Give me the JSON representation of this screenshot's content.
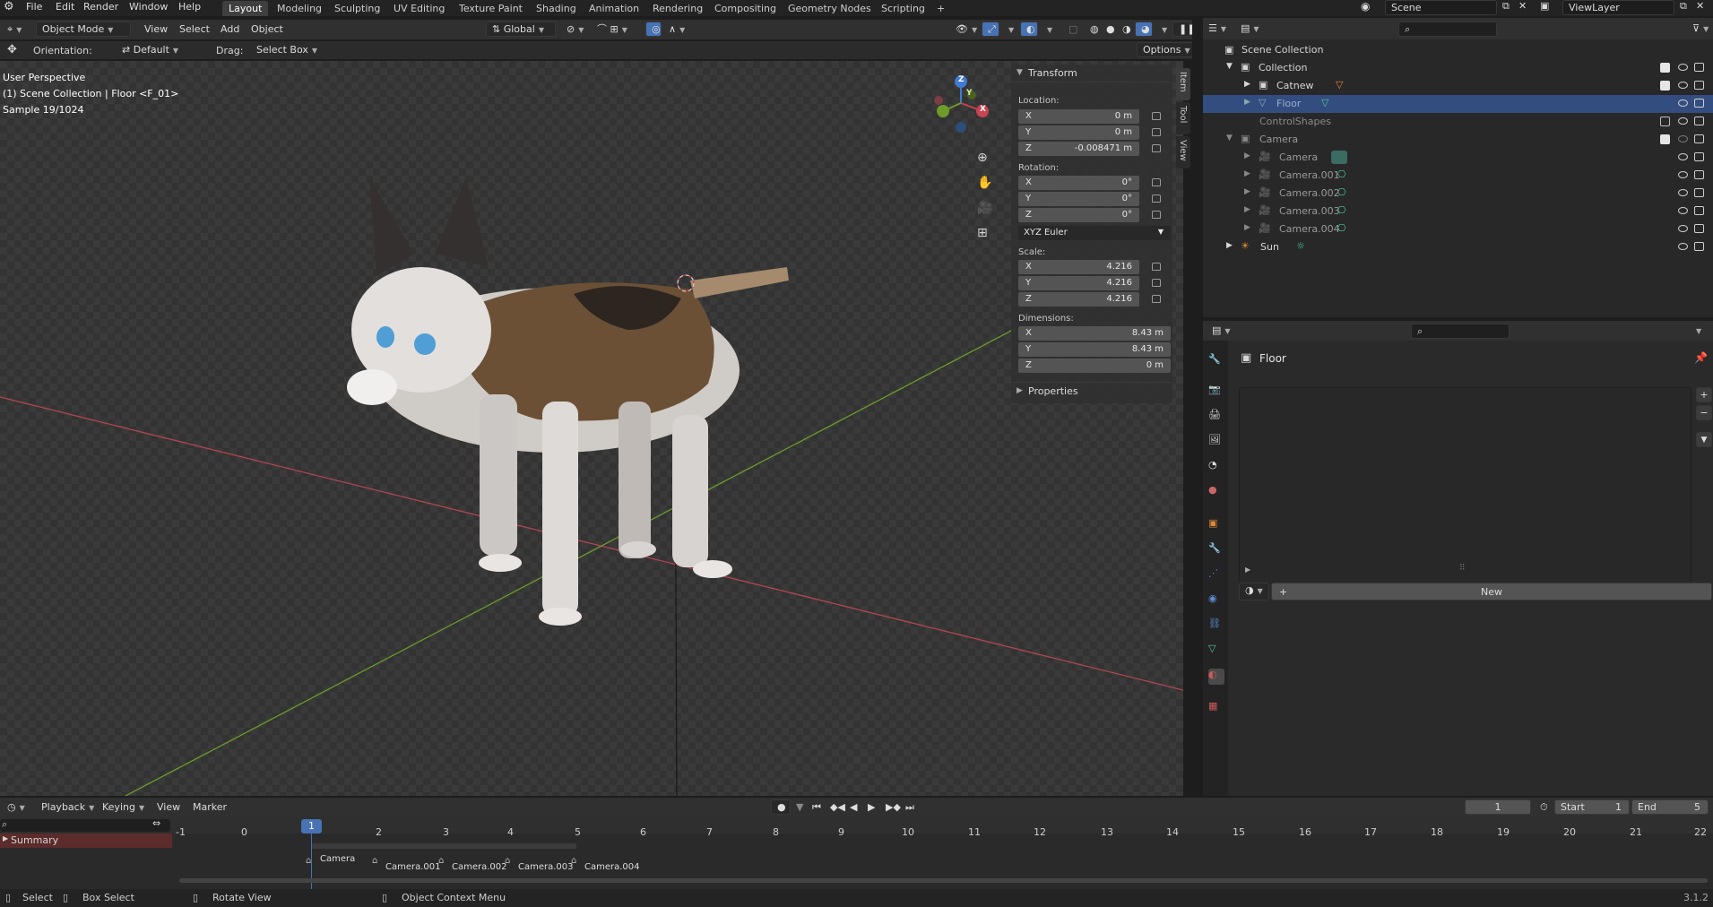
{
  "menu": {
    "items": [
      "File",
      "Edit",
      "Render",
      "Window",
      "Help"
    ]
  },
  "workspaces": [
    "Layout",
    "Modeling",
    "Sculpting",
    "UV Editing",
    "Texture Paint",
    "Shading",
    "Animation",
    "Rendering",
    "Compositing",
    "Geometry Nodes",
    "Scripting",
    "+"
  ],
  "active_workspace": "Layout",
  "scene_name": "Scene",
  "view_layer": "ViewLayer",
  "header": {
    "mode": "Object Mode",
    "view": "View",
    "select": "Select",
    "add": "Add",
    "object": "Object",
    "transform_orientation": "Global"
  },
  "toolsettings": {
    "orientation_label": "Orientation:",
    "orientation_value": "Default",
    "drag_label": "Drag:",
    "drag_value": "Select Box",
    "options": "Options"
  },
  "viewport_info": {
    "line1": "User Perspective",
    "line2": "(1) Scene Collection | Floor <F_01>",
    "line3": "Sample 19/1024"
  },
  "gizmo": {
    "x": "X",
    "y": "Y",
    "z": "Z"
  },
  "npanel": {
    "transform_title": "Transform",
    "location_label": "Location:",
    "location": [
      {
        "axis": "X",
        "value": "0 m"
      },
      {
        "axis": "Y",
        "value": "0 m"
      },
      {
        "axis": "Z",
        "value": "-0.008471 m"
      }
    ],
    "rotation_label": "Rotation:",
    "rotation": [
      {
        "axis": "X",
        "value": "0°"
      },
      {
        "axis": "Y",
        "value": "0°"
      },
      {
        "axis": "Z",
        "value": "0°"
      }
    ],
    "rotation_mode": "XYZ Euler",
    "scale_label": "Scale:",
    "scale": [
      {
        "axis": "X",
        "value": "4.216"
      },
      {
        "axis": "Y",
        "value": "4.216"
      },
      {
        "axis": "Z",
        "value": "4.216"
      }
    ],
    "dimensions_label": "Dimensions:",
    "dimensions": [
      {
        "axis": "X",
        "value": "8.43 m"
      },
      {
        "axis": "Y",
        "value": "8.43 m"
      },
      {
        "axis": "Z",
        "value": "0 m"
      }
    ],
    "properties_title": "Properties",
    "tabs": [
      "Item",
      "Tool",
      "View"
    ]
  },
  "outliner": {
    "rows": [
      {
        "name": "Scene Collection"
      },
      {
        "name": "Collection"
      },
      {
        "name": "Catnew"
      },
      {
        "name": "Floor"
      },
      {
        "name": "ControlShapes"
      },
      {
        "name": "Camera"
      },
      {
        "name": "Camera"
      },
      {
        "name": "Camera.001"
      },
      {
        "name": "Camera.002"
      },
      {
        "name": "Camera.003"
      },
      {
        "name": "Camera.004"
      },
      {
        "name": "Sun"
      }
    ]
  },
  "properties": {
    "object_name": "Floor",
    "new_button": "New"
  },
  "timeline": {
    "playback": "Playback",
    "keying": "Keying",
    "view": "View",
    "marker": "Marker",
    "current_frame": "1",
    "start_label": "Start",
    "start": "1",
    "end_label": "End",
    "end": "5",
    "ticks": [
      "-1",
      "0",
      "1",
      "2",
      "3",
      "4",
      "5",
      "6",
      "7",
      "8",
      "9",
      "10",
      "11",
      "12",
      "13",
      "14",
      "15",
      "16",
      "17",
      "18",
      "19",
      "20",
      "21",
      "22"
    ],
    "summary": "Summary",
    "markers": [
      "Camera",
      "Camera.001",
      "Camera.002",
      "Camera.003",
      "Camera.004"
    ]
  },
  "statusbar": {
    "select": "Select",
    "box_select": "Box Select",
    "rotate_view": "Rotate View",
    "context_menu": "Object Context Menu",
    "version": "3.1.2"
  },
  "colors": {
    "accent_blue": "#4772b3",
    "selected_row": "#334d80",
    "x_axis": "#c8444f",
    "y_axis": "#6e9b2a"
  }
}
